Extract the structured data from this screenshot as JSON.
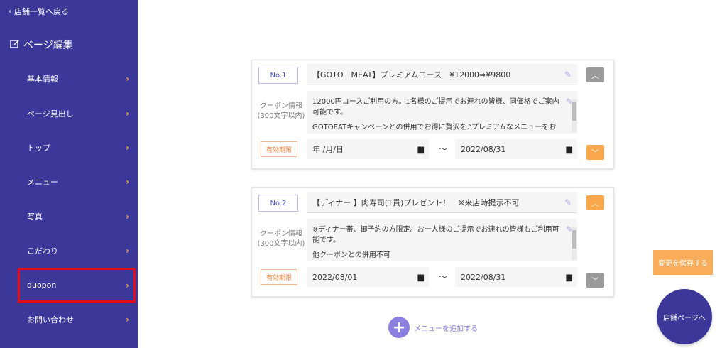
{
  "sidebar": {
    "back_label": "店舗一覧へ戻る",
    "section_title": "ページ編集",
    "items": [
      {
        "label": "基本情報"
      },
      {
        "label": "ページ見出し"
      },
      {
        "label": "トップ"
      },
      {
        "label": "メニュー"
      },
      {
        "label": "写真"
      },
      {
        "label": "こだわり"
      },
      {
        "label": "quopon"
      },
      {
        "label": "お問い合わせ"
      }
    ]
  },
  "coupons": [
    {
      "number": "No.1",
      "title": "【GOTO　MEAT】プレミアムコース　¥12000⇒¥9800",
      "info_label_line1": "クーポン情報",
      "info_label_line2": "(300文字以内)",
      "desc_line1": "12000円コースご利用の方。1名様のご提示でお連れの皆様、同価格でご案内可能です。",
      "desc_line2": "GOTOEATキャンペーンとの併用でお得に贅沢を♪プレミアムなメニューをお楽",
      "valid_label": "有効期限",
      "start_date": "年 /月/日",
      "end_date": "2022/08/31",
      "tilde": "〜"
    },
    {
      "number": "No.2",
      "title": "【ディナー 】肉寿司(1貫)プレゼント！　※来店時提示不可",
      "info_label_line1": "クーポン情報",
      "info_label_line2": "(300文字以内)",
      "desc_line1": "※ディナー帯、御予約の方限定。お一人様のご提示でお連れの皆様もご利用可能です。",
      "desc_line2": "他クーポンとの併用不可",
      "valid_label": "有効期限",
      "start_date": "2022/08/01",
      "end_date": "2022/08/31",
      "tilde": "〜"
    }
  ],
  "add_menu_label": "メニューを追加する",
  "save_label": "変更を保存する",
  "store_page_label": "店舗ページへ",
  "colors": {
    "sidebar_bg": "#3b389a",
    "accent_orange": "#f9ad5a",
    "highlight_red": "#e30d18",
    "add_purple": "#8b7fe0"
  }
}
